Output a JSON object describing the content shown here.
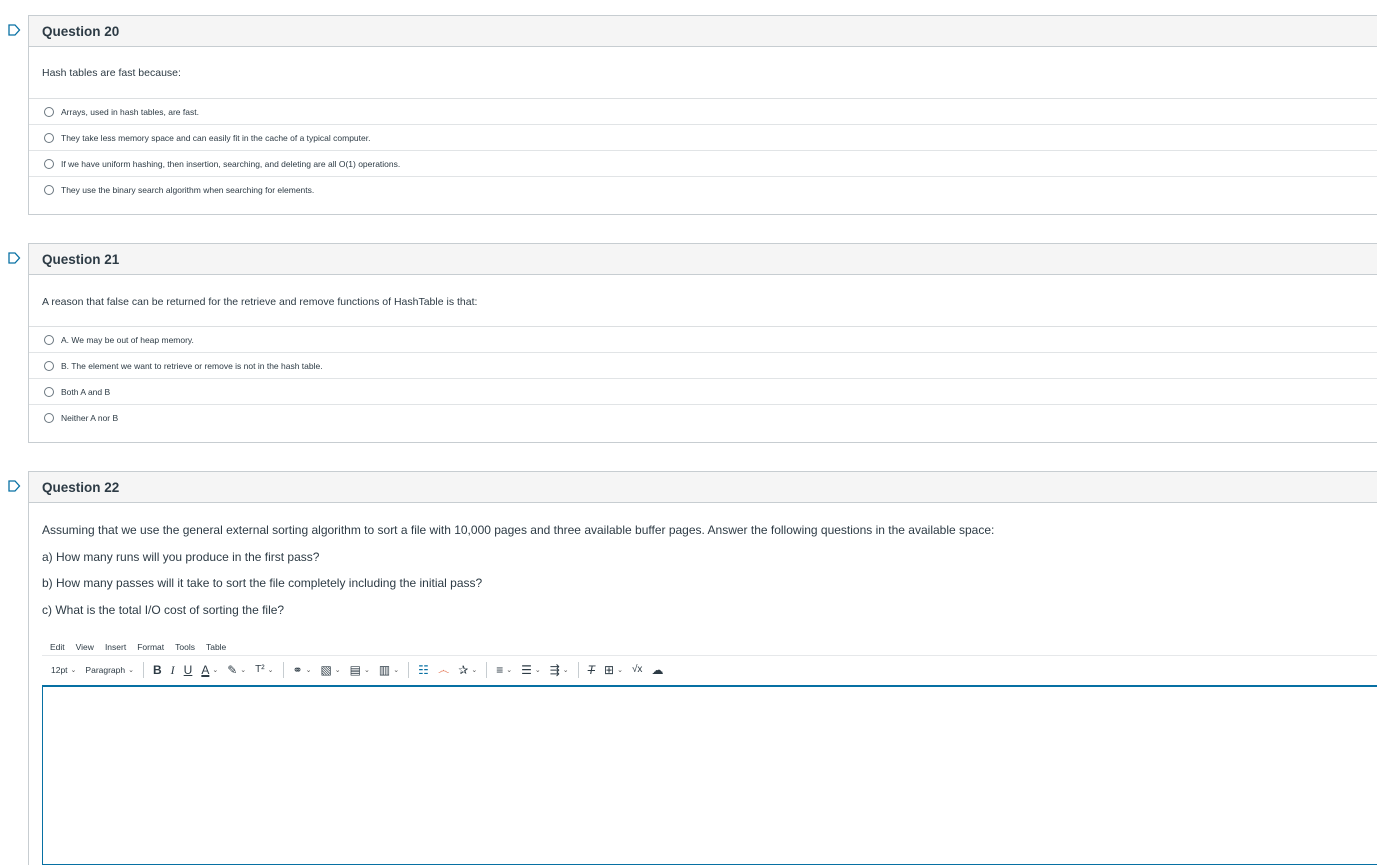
{
  "questions": [
    {
      "title": "Question 20",
      "text": "Hash tables are fast because:",
      "answers": [
        "Arrays, used in hash tables, are fast.",
        "They take less memory space and can easily fit in the cache of a typical computer.",
        "If we have uniform hashing, then insertion, searching, and deleting are all O(1) operations.",
        "They use the binary search algorithm when searching for elements."
      ]
    },
    {
      "title": "Question 21",
      "text": "A reason that false can be returned for the retrieve and remove functions of HashTable is that:",
      "answers": [
        "A. We may be out of heap memory.",
        "B. The element we want to retrieve or remove is not in the hash table.",
        "Both A and B",
        "Neither A nor B"
      ]
    },
    {
      "title": "Question 22",
      "paragraphs": [
        "Assuming that we use the general external sorting algorithm to sort a file with 10,000 pages and three available buffer pages.  Answer the following questions in the available space:",
        "a) How many runs will you produce in the first pass?",
        "b) How many passes will it take to sort the file completely including the initial pass?",
        "c) What is the total I/O cost of sorting the file?"
      ]
    }
  ],
  "editor": {
    "menu": [
      "Edit",
      "View",
      "Insert",
      "Format",
      "Tools",
      "Table"
    ],
    "font_size": "12pt",
    "block_format": "Paragraph",
    "bold": "B",
    "italic": "I",
    "underline": "U",
    "text_color": "A",
    "superscript": "T²"
  },
  "colors": {
    "header_bg": "#f5f5f5",
    "border": "#c7cdd1",
    "flag": "#0770a3",
    "text": "#2d3b45",
    "editor_focus": "#0770a3"
  },
  "icons": {
    "flag": "flag-icon",
    "radio": "radio-button-icon"
  }
}
